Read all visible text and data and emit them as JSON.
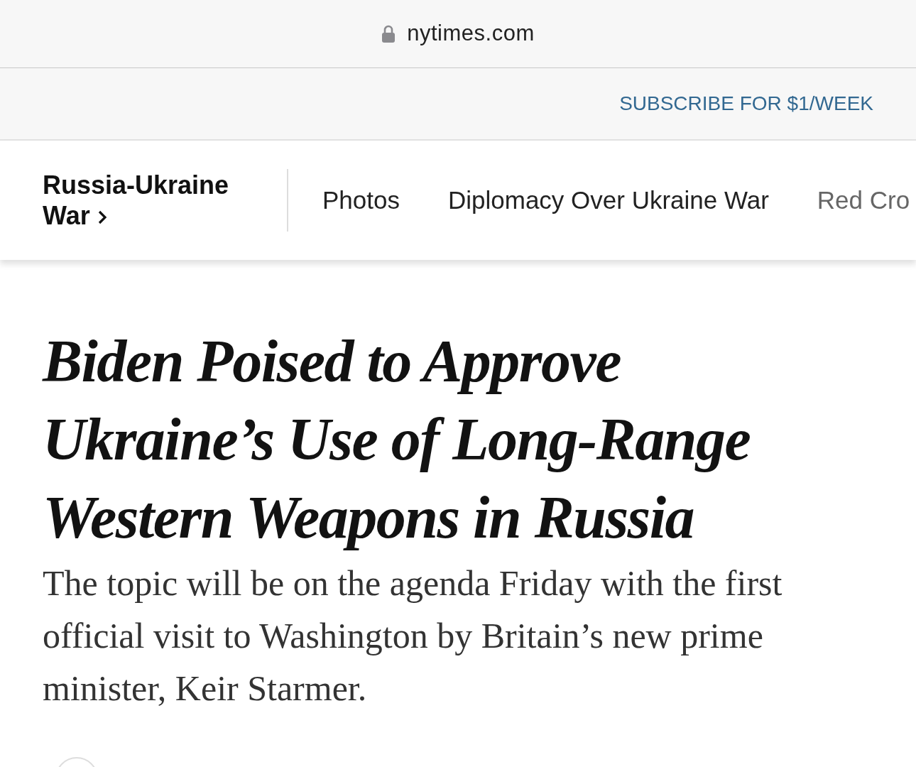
{
  "browser": {
    "url": "nytimes.com",
    "secure": true
  },
  "subscribe": {
    "label": "SUBSCRIBE FOR $1/WEEK"
  },
  "section_nav": {
    "section": "Russia-Ukraine War",
    "links": [
      "Photos",
      "Diplomacy Over Ukraine War",
      "Red Cro"
    ]
  },
  "article": {
    "headline": "Biden Poised to Approve Ukraine’s Use of Long-Range Western Weapons in Russia",
    "summary": "The topic will be on the agenda Friday with the first official visit to Washington by Britain’s new prime minister, Keir Starmer."
  }
}
